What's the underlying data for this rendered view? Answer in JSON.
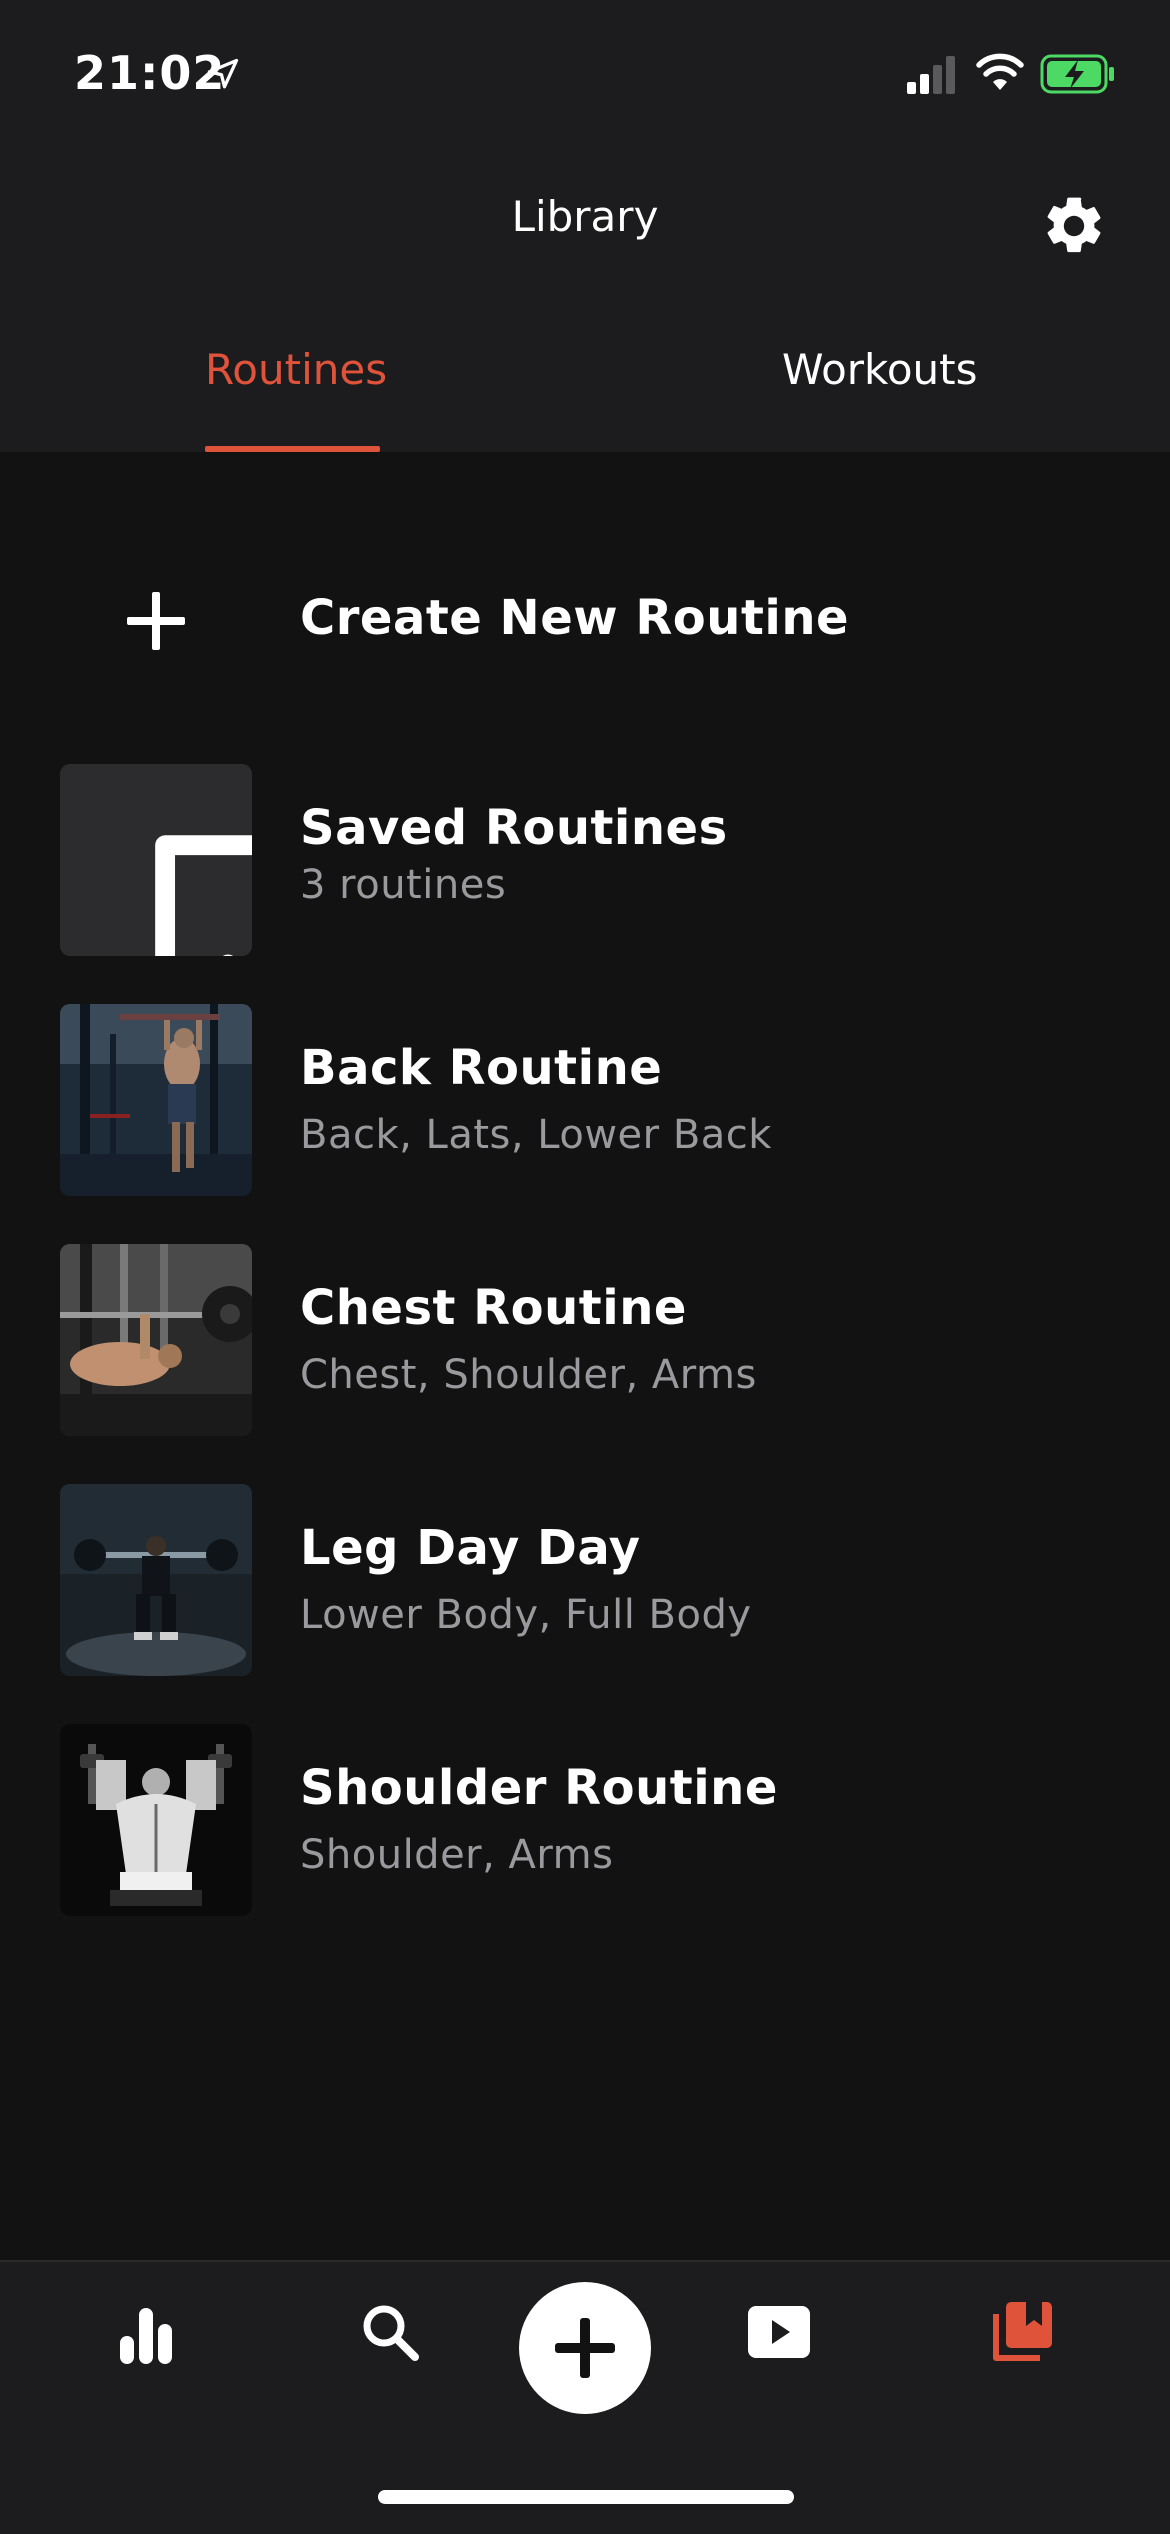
{
  "status_bar": {
    "time": "21:02"
  },
  "header": {
    "title": "Library"
  },
  "tabs": [
    {
      "label": "Routines",
      "active": true
    },
    {
      "label": "Workouts",
      "active": false
    }
  ],
  "create": {
    "label": "Create New Routine"
  },
  "saved": {
    "title": "Saved Routines",
    "subtitle": "3 routines"
  },
  "routines": [
    {
      "title": "Back Routine",
      "subtitle": "Back, Lats, Lower Back"
    },
    {
      "title": "Chest Routine",
      "subtitle": "Chest, Shoulder, Arms"
    },
    {
      "title": "Leg Day Day",
      "subtitle": "Lower Body, Full Body"
    },
    {
      "title": "Shoulder Routine",
      "subtitle": "Shoulder, Arms"
    }
  ],
  "bottom_nav": {
    "items": [
      "stats-icon",
      "search-icon",
      "add-icon",
      "video-icon",
      "library-icon"
    ],
    "active": "library-icon"
  },
  "colors": {
    "accent": "#e0533b",
    "background": "#121212",
    "header": "#1c1c1e",
    "secondary_text": "#9a9a9e"
  }
}
